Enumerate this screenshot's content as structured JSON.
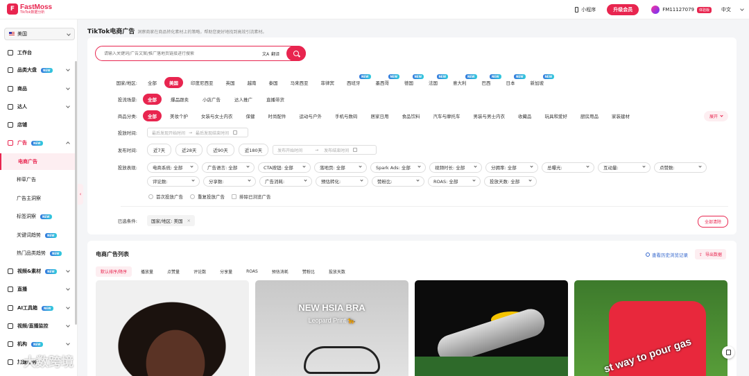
{
  "brand": {
    "title": "FastMoss",
    "subtitle": "TikTok数据分析",
    "mark": "F"
  },
  "topbar": {
    "mini_program": "小程序",
    "upgrade": "升级会员",
    "user_id": "FM11127079",
    "vip": "体验版",
    "language": "中文"
  },
  "sidebar": {
    "region": "美国",
    "items": [
      {
        "label": "工作台"
      },
      {
        "label": "品类大盘",
        "badge": "NEW"
      },
      {
        "label": "商品"
      },
      {
        "label": "达人"
      },
      {
        "label": "店铺"
      },
      {
        "label": "广告",
        "badge": "NEW"
      },
      {
        "label": "视频&素材",
        "badge": "NEW"
      },
      {
        "label": "直播"
      },
      {
        "label": "AI工具箱",
        "badge": "NEW"
      },
      {
        "label": "视频/直播监控"
      },
      {
        "label": "机构",
        "badge": "NEW"
      },
      {
        "label": "加速服务"
      }
    ],
    "sub_items": [
      {
        "label": "电商广告"
      },
      {
        "label": "种草广告"
      },
      {
        "label": "广告主洞察"
      },
      {
        "label": "标签洞察",
        "badge": "NEW"
      },
      {
        "label": "关键词趋势",
        "badge": "NEW"
      },
      {
        "label": "热门品类趋势",
        "badge": "NEW"
      }
    ]
  },
  "page": {
    "title": "TikTok电商广告",
    "description": "洞察商家在商品转化素材上的策略，帮助您更好地找到高效引流素材。"
  },
  "search": {
    "placeholder": "请输入关键词/广告文案/推广落地页链接进行搜索",
    "translate": "翻译"
  },
  "filters": {
    "region_label": "国家/地区:",
    "regions": [
      {
        "label": "全部"
      },
      {
        "label": "美国"
      },
      {
        "label": "印度尼西亚"
      },
      {
        "label": "英国"
      },
      {
        "label": "越南"
      },
      {
        "label": "泰国"
      },
      {
        "label": "马来西亚"
      },
      {
        "label": "菲律宾"
      },
      {
        "label": "西班牙",
        "badge": "NEW"
      },
      {
        "label": "墨西哥",
        "badge": "NEW"
      },
      {
        "label": "德国",
        "badge": "NEW"
      },
      {
        "label": "法国",
        "badge": "NEW"
      },
      {
        "label": "意大利",
        "badge": "NEW"
      },
      {
        "label": "巴西",
        "badge": "NEW"
      },
      {
        "label": "日本",
        "badge": "NEW"
      },
      {
        "label": "新加坡",
        "badge": "NEW"
      }
    ],
    "scene_label": "投流场景:",
    "scenes": [
      "全部",
      "爆品跟卖",
      "小店广告",
      "达人推广",
      "直播带货"
    ],
    "category_label": "商品分类:",
    "categories": [
      "全部",
      "美妆个护",
      "女装与女士内衣",
      "保健",
      "时尚配件",
      "运动与户外",
      "手机与数码",
      "居家日用",
      "食品饮料",
      "汽车与摩托车",
      "男装与男士内衣",
      "收藏品",
      "玩具和爱好",
      "厨房用品",
      "家装建材"
    ],
    "expand": "展开",
    "launch_label": "投放时间:",
    "launch_start": "最后发现开始时间",
    "launch_end": "最后发现结束时间",
    "publish_label": "发布时间:",
    "publish_quick": [
      "近7天",
      "近28天",
      "近90天",
      "近180天"
    ],
    "publish_start": "发布开始时间",
    "publish_end": "发布结束时间",
    "perf_label": "投放表现:",
    "perf_row1": [
      "电商系统: 全部",
      "广告语言: 全部",
      "CTA按钮: 全部",
      "落地页: 全部",
      "Spark Ads: 全部",
      "视频时长: 全部",
      "分拥率: 全部",
      "总曝光:",
      "互动量:",
      "点赞数:"
    ],
    "perf_row2": [
      "评论数:",
      "分享数:",
      "广告消耗:",
      "预估转化:",
      "赞粉比:",
      "ROAS: 全部",
      "投放天数: 全部"
    ],
    "checks": [
      "首次投放广告",
      "重复投放广告",
      "排除已浏览广告"
    ],
    "selected_label": "已选条件:",
    "selected_tag": "国家/地区: 美国",
    "clear": "全部清除"
  },
  "list": {
    "title": "电商广告列表",
    "history": "查看历史浏览记录",
    "export": "导出数据",
    "sorts": [
      "默认排序/降序",
      "播放量",
      "点赞量",
      "评论数",
      "分享量",
      "ROAS",
      "预估消耗",
      "赞粉比",
      "投放天数"
    ],
    "thumb2_text1": "NEW HSIA BRA",
    "thumb2_text2": "Leopard Print 🐆",
    "thumb4_text": "st way to pour gas"
  },
  "watermark": "大数跨境",
  "colors": {
    "accent": "#e8254f",
    "badge": "#37d",
    "link": "#36c"
  }
}
